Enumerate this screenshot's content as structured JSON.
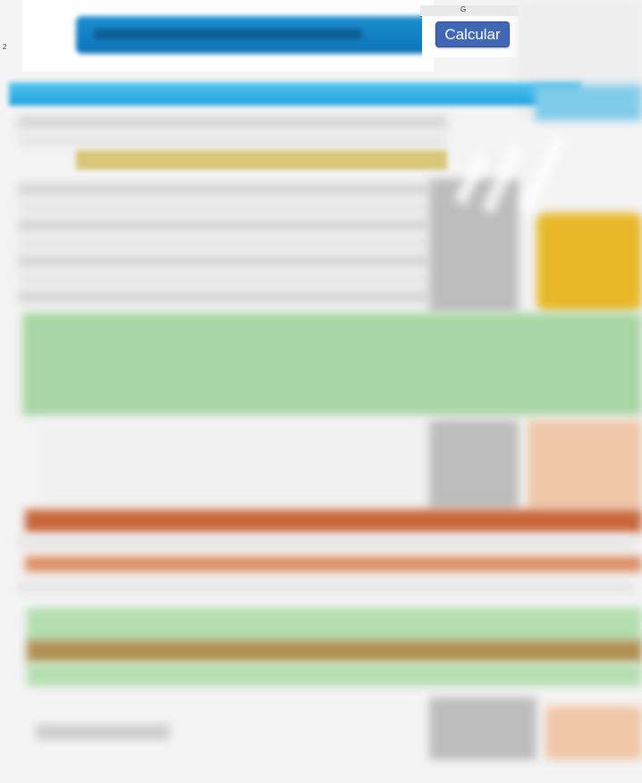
{
  "toolbar": {
    "calcular_label": "Calcular"
  },
  "grid": {
    "column_letter": "G",
    "row_numbers": [
      "2"
    ]
  },
  "colors": {
    "title_blue": "#0a73b7",
    "band_blue": "#1aa3dd",
    "button_blue": "#3f67b5",
    "green": "#a9d6a5",
    "orange": "#c8663a",
    "yellow": "#e8b82a"
  }
}
